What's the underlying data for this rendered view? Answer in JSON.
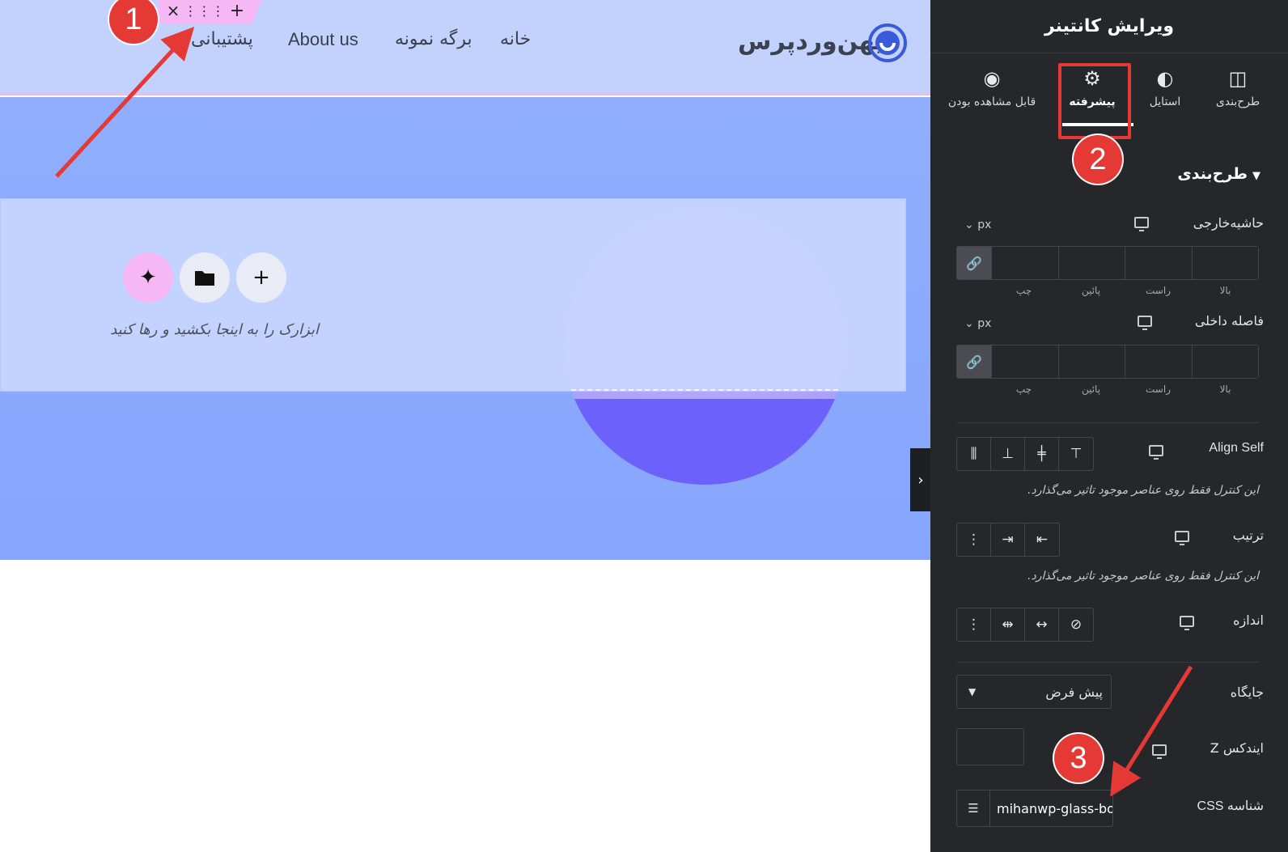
{
  "site": {
    "logo_text": "میهن‌وردپرس",
    "nav": [
      "خانه",
      "برگه نمونه",
      "About us",
      "پشتیبانی"
    ]
  },
  "canvas": {
    "drop_text": "ابزارک را به اینجا بکشید و رها کنید",
    "handle": {
      "close_icon": "×",
      "drag_icon": "⋮⋮⋮",
      "plus_icon": "+"
    },
    "buttons": {
      "ai_icon": "✦",
      "folder_icon": "▮",
      "add_icon": "+"
    }
  },
  "badges": [
    "1",
    "2",
    "3"
  ],
  "panel": {
    "title": "ویرایش کانتینر",
    "tabs": [
      {
        "label": "طرح‌بندی",
        "icon": "layout-icon"
      },
      {
        "label": "استایل",
        "icon": "half-circle-icon"
      },
      {
        "label": "پیشرفته",
        "icon": "gear-icon"
      },
      {
        "label": "قابل مشاهده بودن",
        "icon": "eye-icon"
      }
    ],
    "section_title": "طرح‌بندی",
    "margin": {
      "label": "حاشیه‌خارجی",
      "unit": "px"
    },
    "padding": {
      "label": "فاصله داخلی",
      "unit": "px"
    },
    "dim_labels": [
      "چپ",
      "پائین",
      "راست",
      "بالا"
    ],
    "align_self": {
      "label": "Align Self"
    },
    "order": {
      "label": "ترتیب"
    },
    "size": {
      "label": "اندازه"
    },
    "note": "این کنترل فقط روی عناصر موجود تاثیر می‌گذارد.",
    "position": {
      "label": "جایگاه",
      "value": "پیش فرض"
    },
    "z_index": {
      "label": "ایندکس Z"
    },
    "css_id": {
      "label": "شناسه CSS",
      "value": "mihanwp-glass-box"
    }
  },
  "colors": {
    "accent_red": "#e53935",
    "header_bg": "#c2d2fd",
    "hero_bg": "#86a6fd",
    "panel_bg": "#26272b",
    "circle_light": "#aaa1fb",
    "circle_dark": "#6c5dfb"
  }
}
